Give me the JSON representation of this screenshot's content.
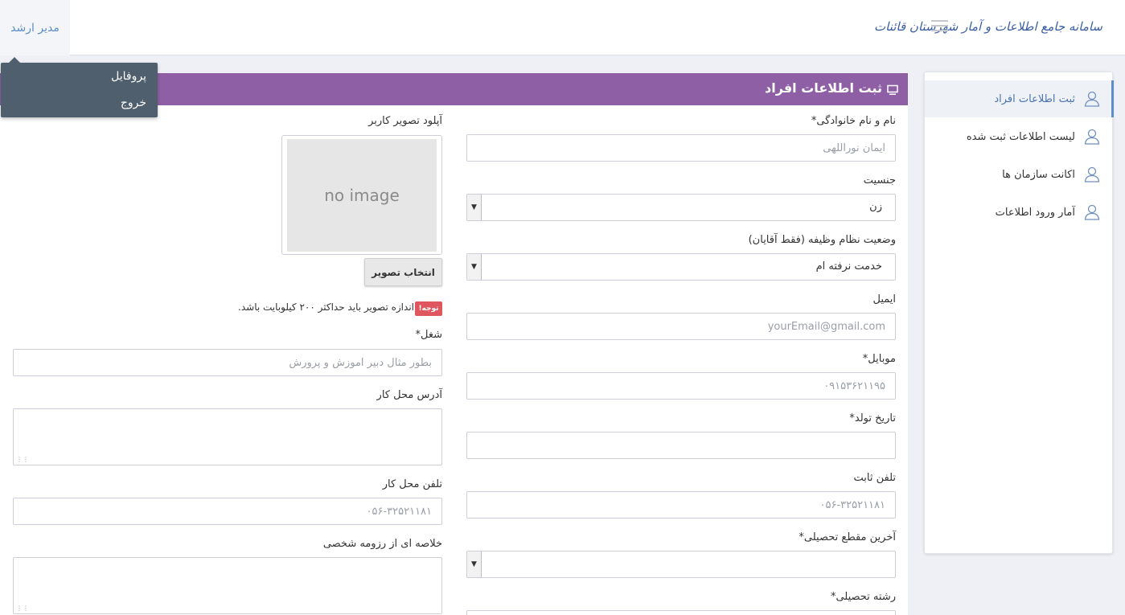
{
  "header": {
    "brand": "سامانه جامع اطلاعات و آمار شهرستان قائنات",
    "menu_icon": "hamburger-icon",
    "user_label": "مدیر ارشد"
  },
  "user_menu": {
    "items": [
      "پروفایل",
      "خروج"
    ]
  },
  "sidebar": {
    "items": [
      {
        "label": "ثبت اطلاعات افراد",
        "icon": "user-icon",
        "active": true
      },
      {
        "label": "لیست اطلاعات ثبت شده",
        "icon": "user-icon",
        "active": false
      },
      {
        "label": "اکانت سازمان ها",
        "icon": "user-icon",
        "active": false
      },
      {
        "label": "آمار ورود اطلاعات",
        "icon": "user-icon",
        "active": false
      }
    ]
  },
  "panel": {
    "title": "ثبت اطلاعات افراد",
    "title_icon": "monitor-icon",
    "header_color": "#8e5fa5"
  },
  "form": {
    "fullname": {
      "label": "نام و نام خانوادگی*",
      "placeholder": "ایمان نوراللهی"
    },
    "gender": {
      "label": "جنسیت",
      "value": "زن"
    },
    "military": {
      "label": "وضعیت نظام وظیفه (فقط آقایان)",
      "value": "خدمت نرفته ام"
    },
    "email": {
      "label": "ایمیل",
      "placeholder": "yourEmail@gmail.com"
    },
    "mobile": {
      "label": "موبایل*",
      "placeholder": "۰۹۱۵۳۶۲۱۱۹۵"
    },
    "birthdate": {
      "label": "تاریخ تولد*",
      "value": ""
    },
    "phone": {
      "label": "تلفن ثابت",
      "placeholder": "۰۵۶-۳۲۵۲۱۱۸۱"
    },
    "education": {
      "label": "آخرین مقطع تحصیلی*",
      "value": ""
    },
    "field": {
      "label": "رشته تحصیلی*"
    },
    "photo": {
      "label": "آپلود تصویر کاربر",
      "placeholder_text": "no image",
      "button": "انتخاب تصویر",
      "note_badge": "توجه!",
      "note": "اندازه تصویر باید حداکثر ۲۰۰ کیلوبایت باشد."
    },
    "job": {
      "label": "شغل*",
      "placeholder": "بطور مثال دبیر آموزش و پرورش"
    },
    "work_address": {
      "label": "آدرس محل کار"
    },
    "work_phone": {
      "label": "تلفن محل کار",
      "placeholder": "۰۵۶-۳۲۵۲۱۱۸۱"
    },
    "resume": {
      "label": "خلاصه ای از رزومه شخصی"
    }
  }
}
